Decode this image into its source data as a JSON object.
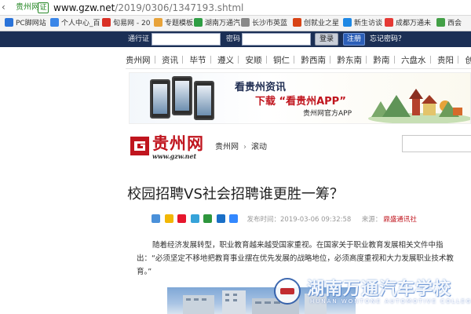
{
  "address_bar": {
    "site_label": "贵州网",
    "cert_label": "证",
    "url_host": "www.gzw.net",
    "url_path": "/2019/0306/1347193.shtml"
  },
  "bookmarks": [
    {
      "label": "PC脚网站",
      "color": "#2a73d9"
    },
    {
      "label": "个人中心_百",
      "color": "#3a86e8"
    },
    {
      "label": "旬易网 - 20",
      "color": "#d93025"
    },
    {
      "label": "专题模板",
      "color": "#e8a33a"
    },
    {
      "label": "湖南万通汽",
      "color": "#2f9e44"
    },
    {
      "label": "长沙市英蓝",
      "color": "#888888"
    },
    {
      "label": "创就业之星",
      "color": "#d84315"
    },
    {
      "label": "新生访谈",
      "color": "#1e88e5"
    },
    {
      "label": "成都万通未",
      "color": "#e53935"
    },
    {
      "label": "西会",
      "color": "#43a047"
    }
  ],
  "login_bar": {
    "id_label": "通行证",
    "password_label": "密码",
    "login_button": "登录",
    "register_button": "注册",
    "forgot_link": "忘记密码？"
  },
  "nav": [
    "贵州网",
    "资讯",
    "毕节",
    "遵义",
    "安顺",
    "铜仁",
    "黔西南",
    "黔东南",
    "黔南",
    "六盘水",
    "贵阳",
    "创业"
  ],
  "banner": {
    "line1": "看贵州资讯",
    "line2": "下载 “看贵州APP”",
    "line3": "贵州网官方APP"
  },
  "logo": {
    "name": "贵州网",
    "domain": "www.gzw.net"
  },
  "breadcrumb": [
    "贵州网",
    "滚动"
  ],
  "article": {
    "title": "校园招聘VS社会招聘谁更胜一筹？",
    "share_icons": [
      {
        "name": "plus-share-icon",
        "color": "#4a90d9"
      },
      {
        "name": "qzone-share-icon",
        "color": "#f2b705"
      },
      {
        "name": "weibo-share-icon",
        "color": "#e6162d"
      },
      {
        "name": "tencent-weibo-share-icon",
        "color": "#36a3d9"
      },
      {
        "name": "douban-share-icon",
        "color": "#2e963d"
      },
      {
        "name": "renren-share-icon",
        "color": "#1a6fc7"
      },
      {
        "name": "baidu-share-icon",
        "color": "#3388ff"
      }
    ],
    "publish_label": "发布时间：",
    "publish_time": "2019-03-06 09:32:58",
    "source_label": "来源：",
    "source": "鼎盛通讯社",
    "paragraph": "随着经济发展转型，职业教育越来越受国家重视。在国家关于职业教育发展相关文件中指出：“必须坚定不移地把教育事业摆在优先发展的战略地位，必须高度重视和大力发展职业技术教育。”"
  },
  "watermark": {
    "cn": "湖南万通汽车学校",
    "en": "HUNAN WONTONE AUTOMOTIVE COLLEGE"
  }
}
